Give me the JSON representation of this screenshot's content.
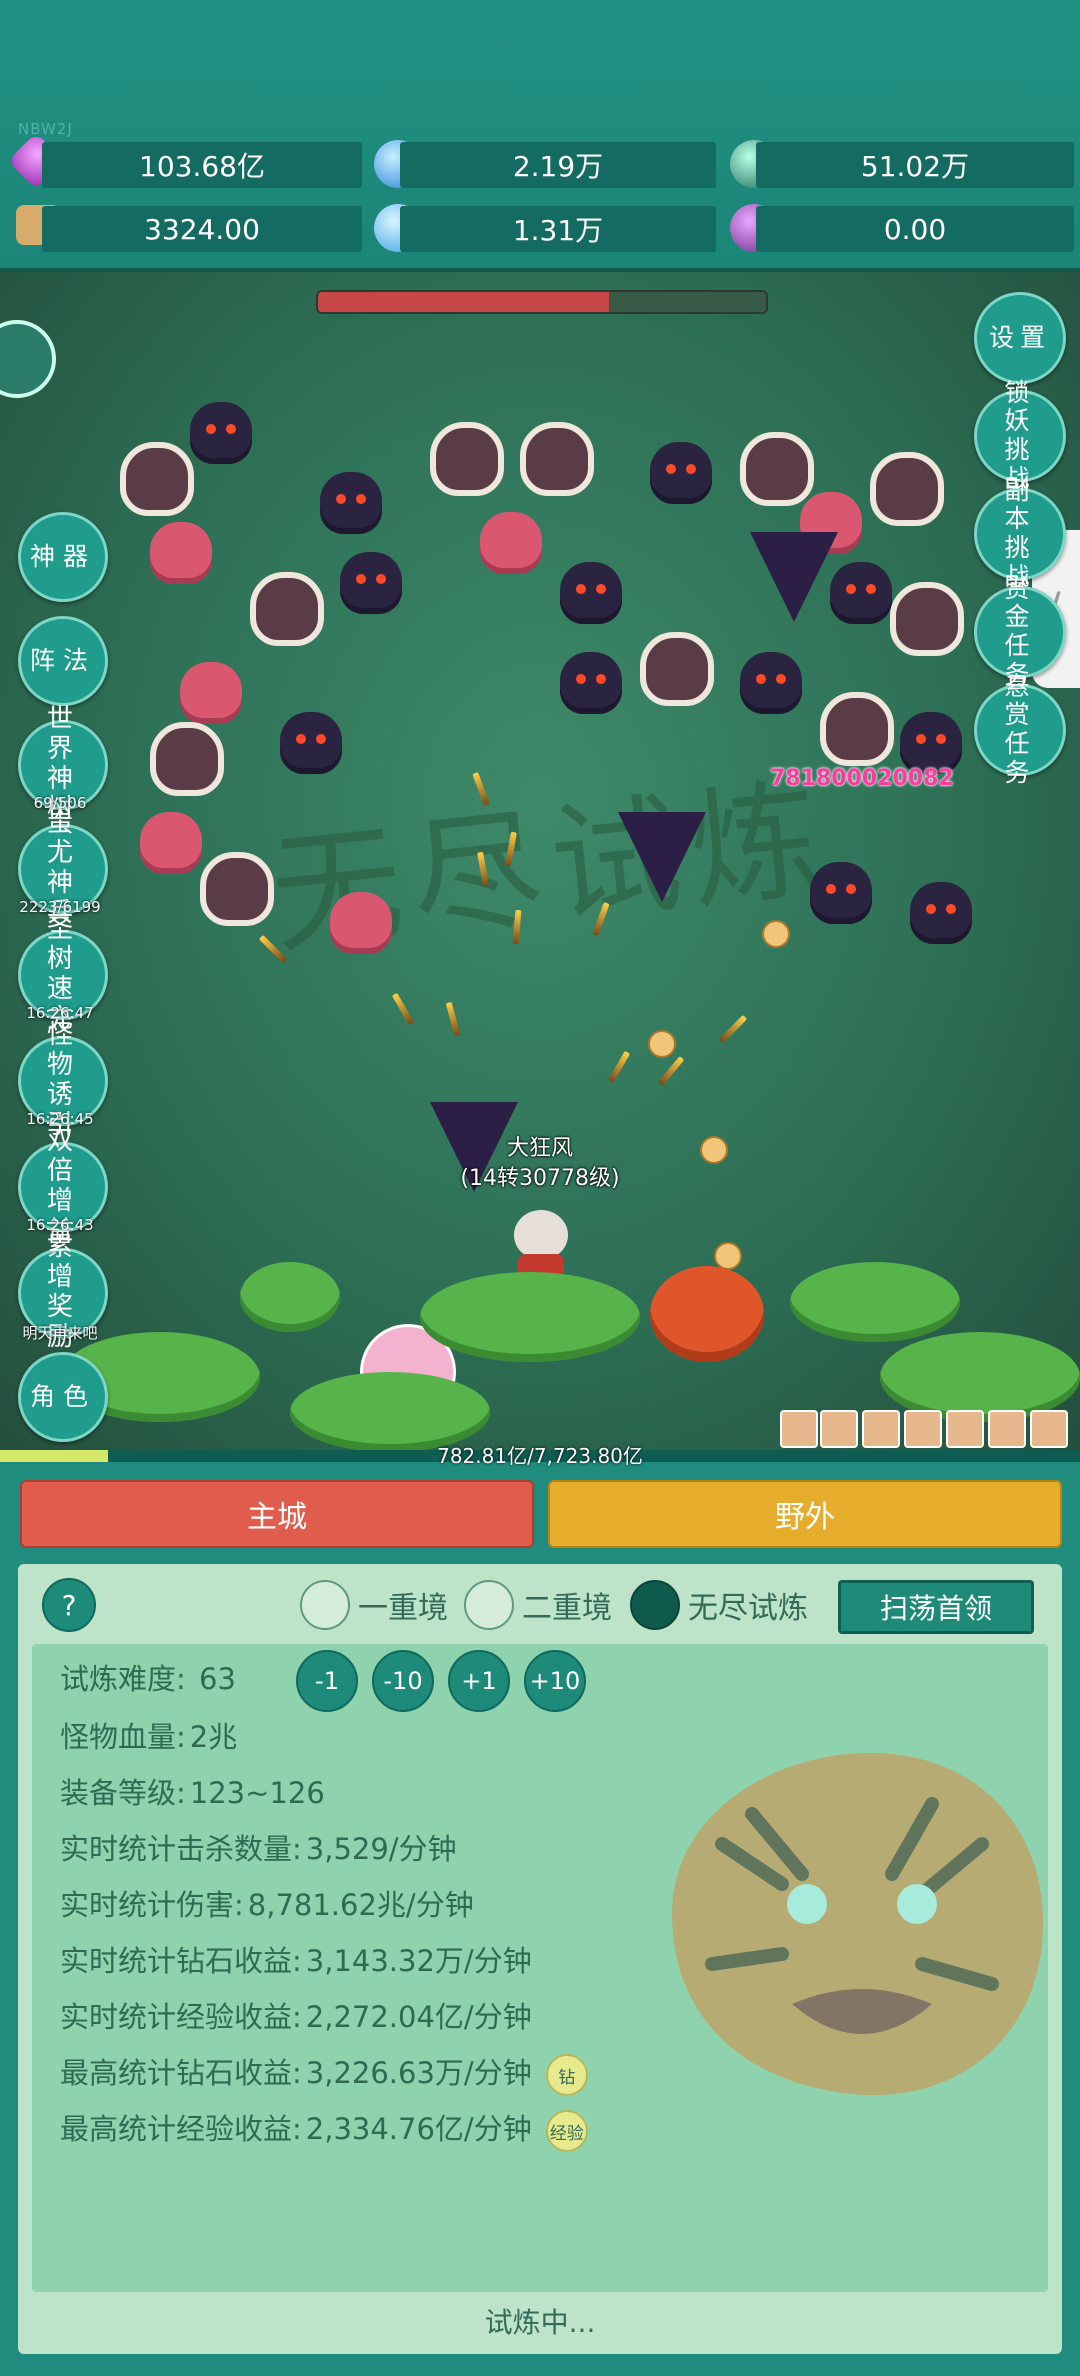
{
  "watermark": "NBW2J",
  "resources": [
    {
      "icon": "purple-gem-icon",
      "value": "103.68亿"
    },
    {
      "icon": "blue-crystal-icon",
      "value": "2.19万"
    },
    {
      "icon": "green-orb-icon",
      "value": "51.02万"
    },
    {
      "icon": "scroll-icon",
      "value": "3324.00"
    },
    {
      "icon": "ice-shard-icon",
      "value": "1.31万"
    },
    {
      "icon": "purple-pouch-icon",
      "value": "0.00"
    }
  ],
  "battle": {
    "boss_hp_fraction": 0.65,
    "background_text": "无尽试炼",
    "damage_popup": "781800020082",
    "hero_name": "大狂风",
    "hero_level": "(14转30778级)",
    "xp_text": "782.81亿/7,723.80亿",
    "xp_fraction": 0.1
  },
  "left_menu": [
    {
      "label": "神器",
      "sub": ""
    },
    {
      "label": "阵法",
      "sub": ""
    },
    {
      "label": "世界神树",
      "sub": "69/506"
    },
    {
      "label": "蚩尤神兵",
      "sub": "2223/6199"
    },
    {
      "label": "圣树速充",
      "sub": "16:26:47"
    },
    {
      "label": "怪物诱引",
      "sub": "16:26:45"
    },
    {
      "label": "双倍增益",
      "sub": "16:26:43"
    },
    {
      "label": "累增奖励",
      "sub": "明天再来吧"
    },
    {
      "label": "角色",
      "sub": ""
    }
  ],
  "right_menu": [
    {
      "label": "设置"
    },
    {
      "label": "锁妖挑战"
    },
    {
      "label": "副本挑战"
    },
    {
      "label": "赏金任务"
    },
    {
      "label": "悬赏任务"
    }
  ],
  "tabs": {
    "city": "主城",
    "wild": "野外"
  },
  "panel": {
    "help": "?",
    "modes": [
      {
        "label": "一重境",
        "selected": false
      },
      {
        "label": "二重境",
        "selected": false
      },
      {
        "label": "无尽试炼",
        "selected": true
      }
    ],
    "sweep_button": "扫荡首领",
    "difficulty_label": "试炼难度:",
    "difficulty_value": "63",
    "difficulty_buttons": [
      "-1",
      "-10",
      "+1",
      "+10"
    ],
    "stats": [
      {
        "label": "怪物血量:",
        "value": "2兆",
        "tag": ""
      },
      {
        "label": "装备等级:",
        "value": "123~126",
        "tag": ""
      },
      {
        "label": "实时统计击杀数量:",
        "value": "3,529/分钟",
        "tag": ""
      },
      {
        "label": "实时统计伤害:",
        "value": "8,781.62兆/分钟",
        "tag": ""
      },
      {
        "label": "实时统计钻石收益:",
        "value": "3,143.32万/分钟",
        "tag": ""
      },
      {
        "label": "实时统计经验收益:",
        "value": "2,272.04亿/分钟",
        "tag": ""
      },
      {
        "label": "最高统计钻石收益:",
        "value": "3,226.63万/分钟",
        "tag": "钻"
      },
      {
        "label": "最高统计经验收益:",
        "value": "2,334.76亿/分钟",
        "tag": "经验"
      }
    ],
    "status": "试炼中..."
  },
  "colors": {
    "teal": "#1f8c7d",
    "city_tab": "#e05c4c",
    "wild_tab": "#e6ad2c",
    "panel": "#bde3c8"
  }
}
